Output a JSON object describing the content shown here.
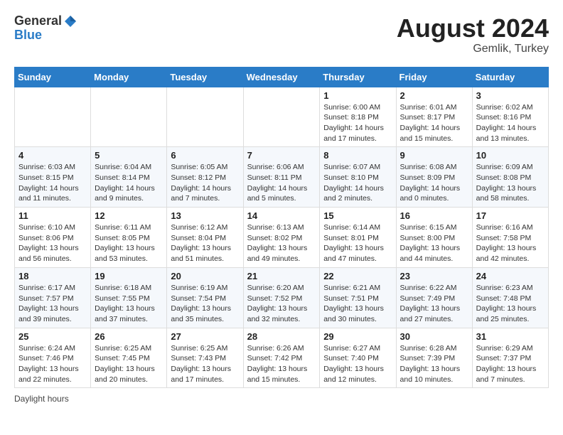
{
  "logo": {
    "general": "General",
    "blue": "Blue"
  },
  "title": "August 2024",
  "location": "Gemlik, Turkey",
  "days_of_week": [
    "Sunday",
    "Monday",
    "Tuesday",
    "Wednesday",
    "Thursday",
    "Friday",
    "Saturday"
  ],
  "footer": "Daylight hours",
  "weeks": [
    [
      {
        "day": "",
        "info": ""
      },
      {
        "day": "",
        "info": ""
      },
      {
        "day": "",
        "info": ""
      },
      {
        "day": "",
        "info": ""
      },
      {
        "day": "1",
        "info": "Sunrise: 6:00 AM\nSunset: 8:18 PM\nDaylight: 14 hours\nand 17 minutes."
      },
      {
        "day": "2",
        "info": "Sunrise: 6:01 AM\nSunset: 8:17 PM\nDaylight: 14 hours\nand 15 minutes."
      },
      {
        "day": "3",
        "info": "Sunrise: 6:02 AM\nSunset: 8:16 PM\nDaylight: 14 hours\nand 13 minutes."
      }
    ],
    [
      {
        "day": "4",
        "info": "Sunrise: 6:03 AM\nSunset: 8:15 PM\nDaylight: 14 hours\nand 11 minutes."
      },
      {
        "day": "5",
        "info": "Sunrise: 6:04 AM\nSunset: 8:14 PM\nDaylight: 14 hours\nand 9 minutes."
      },
      {
        "day": "6",
        "info": "Sunrise: 6:05 AM\nSunset: 8:12 PM\nDaylight: 14 hours\nand 7 minutes."
      },
      {
        "day": "7",
        "info": "Sunrise: 6:06 AM\nSunset: 8:11 PM\nDaylight: 14 hours\nand 5 minutes."
      },
      {
        "day": "8",
        "info": "Sunrise: 6:07 AM\nSunset: 8:10 PM\nDaylight: 14 hours\nand 2 minutes."
      },
      {
        "day": "9",
        "info": "Sunrise: 6:08 AM\nSunset: 8:09 PM\nDaylight: 14 hours\nand 0 minutes."
      },
      {
        "day": "10",
        "info": "Sunrise: 6:09 AM\nSunset: 8:08 PM\nDaylight: 13 hours\nand 58 minutes."
      }
    ],
    [
      {
        "day": "11",
        "info": "Sunrise: 6:10 AM\nSunset: 8:06 PM\nDaylight: 13 hours\nand 56 minutes."
      },
      {
        "day": "12",
        "info": "Sunrise: 6:11 AM\nSunset: 8:05 PM\nDaylight: 13 hours\nand 53 minutes."
      },
      {
        "day": "13",
        "info": "Sunrise: 6:12 AM\nSunset: 8:04 PM\nDaylight: 13 hours\nand 51 minutes."
      },
      {
        "day": "14",
        "info": "Sunrise: 6:13 AM\nSunset: 8:02 PM\nDaylight: 13 hours\nand 49 minutes."
      },
      {
        "day": "15",
        "info": "Sunrise: 6:14 AM\nSunset: 8:01 PM\nDaylight: 13 hours\nand 47 minutes."
      },
      {
        "day": "16",
        "info": "Sunrise: 6:15 AM\nSunset: 8:00 PM\nDaylight: 13 hours\nand 44 minutes."
      },
      {
        "day": "17",
        "info": "Sunrise: 6:16 AM\nSunset: 7:58 PM\nDaylight: 13 hours\nand 42 minutes."
      }
    ],
    [
      {
        "day": "18",
        "info": "Sunrise: 6:17 AM\nSunset: 7:57 PM\nDaylight: 13 hours\nand 39 minutes."
      },
      {
        "day": "19",
        "info": "Sunrise: 6:18 AM\nSunset: 7:55 PM\nDaylight: 13 hours\nand 37 minutes."
      },
      {
        "day": "20",
        "info": "Sunrise: 6:19 AM\nSunset: 7:54 PM\nDaylight: 13 hours\nand 35 minutes."
      },
      {
        "day": "21",
        "info": "Sunrise: 6:20 AM\nSunset: 7:52 PM\nDaylight: 13 hours\nand 32 minutes."
      },
      {
        "day": "22",
        "info": "Sunrise: 6:21 AM\nSunset: 7:51 PM\nDaylight: 13 hours\nand 30 minutes."
      },
      {
        "day": "23",
        "info": "Sunrise: 6:22 AM\nSunset: 7:49 PM\nDaylight: 13 hours\nand 27 minutes."
      },
      {
        "day": "24",
        "info": "Sunrise: 6:23 AM\nSunset: 7:48 PM\nDaylight: 13 hours\nand 25 minutes."
      }
    ],
    [
      {
        "day": "25",
        "info": "Sunrise: 6:24 AM\nSunset: 7:46 PM\nDaylight: 13 hours\nand 22 minutes."
      },
      {
        "day": "26",
        "info": "Sunrise: 6:25 AM\nSunset: 7:45 PM\nDaylight: 13 hours\nand 20 minutes."
      },
      {
        "day": "27",
        "info": "Sunrise: 6:25 AM\nSunset: 7:43 PM\nDaylight: 13 hours\nand 17 minutes."
      },
      {
        "day": "28",
        "info": "Sunrise: 6:26 AM\nSunset: 7:42 PM\nDaylight: 13 hours\nand 15 minutes."
      },
      {
        "day": "29",
        "info": "Sunrise: 6:27 AM\nSunset: 7:40 PM\nDaylight: 13 hours\nand 12 minutes."
      },
      {
        "day": "30",
        "info": "Sunrise: 6:28 AM\nSunset: 7:39 PM\nDaylight: 13 hours\nand 10 minutes."
      },
      {
        "day": "31",
        "info": "Sunrise: 6:29 AM\nSunset: 7:37 PM\nDaylight: 13 hours\nand 7 minutes."
      }
    ]
  ]
}
